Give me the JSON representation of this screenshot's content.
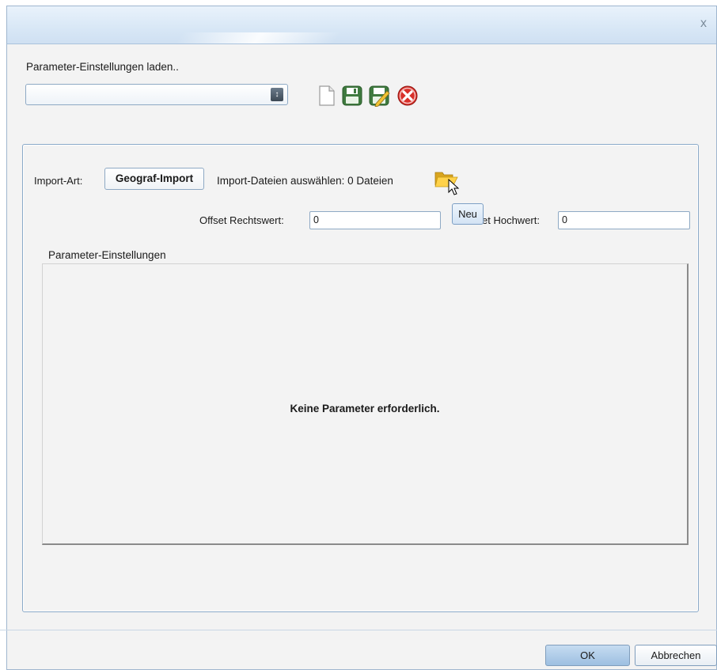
{
  "window": {
    "close_glyph": "x"
  },
  "load_settings": {
    "label": "Parameter-Einstellungen laden..",
    "combo_value": "",
    "toolbar_icons": [
      "new-document-icon",
      "save-icon",
      "save-as-edit-icon",
      "delete-icon"
    ]
  },
  "import": {
    "type_label": "Import-Art:",
    "type_button": "Geograf-Import",
    "files_label": "Import-Dateien auswählen: 0 Dateien",
    "folder_icon": "folder-open-icon",
    "offset_rechtswert_label": "Offset Rechtswert:",
    "offset_rechtswert_value": "0",
    "offset_hochwert_label": "et Hochwert:",
    "offset_hochwert_value": "0",
    "tooltip": "Neu"
  },
  "parameters": {
    "label": "Parameter-Einstellungen",
    "message": "Keine Parameter erforderlich."
  },
  "footer": {
    "ok_label": "OK",
    "cancel_label": "Abbrechen"
  },
  "colors": {
    "accent": "#9dbfe1",
    "border": "#8aa9c8",
    "background": "#f3f3f3"
  }
}
